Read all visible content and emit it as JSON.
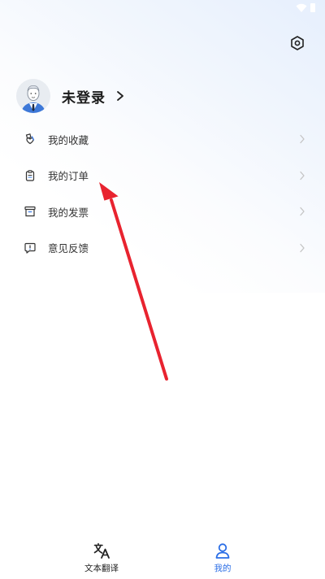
{
  "colors": {
    "accent": "#2b6ee6",
    "annotation_arrow": "#e8232f",
    "text_primary": "#1b1b1b",
    "text_menu": "#333333",
    "chevron": "#c4c4c4"
  },
  "status_bar": {
    "icons": [
      "wifi-icon",
      "battery-icon"
    ]
  },
  "header": {
    "settings_icon": "settings-hexagon-icon"
  },
  "profile": {
    "name": "未登录",
    "avatar_icon": "default-avatar-icon"
  },
  "menu": {
    "items": [
      {
        "label": "我的收藏",
        "icon": "favorites-icon"
      },
      {
        "label": "我的订单",
        "icon": "orders-clipboard-icon"
      },
      {
        "label": "我的发票",
        "icon": "invoice-box-icon"
      },
      {
        "label": "意见反馈",
        "icon": "feedback-chat-icon"
      }
    ]
  },
  "tab_bar": {
    "tabs": [
      {
        "label": "文本翻译",
        "icon": "translate-icon",
        "active": false
      },
      {
        "label": "我的",
        "icon": "person-icon",
        "active": true
      }
    ]
  }
}
